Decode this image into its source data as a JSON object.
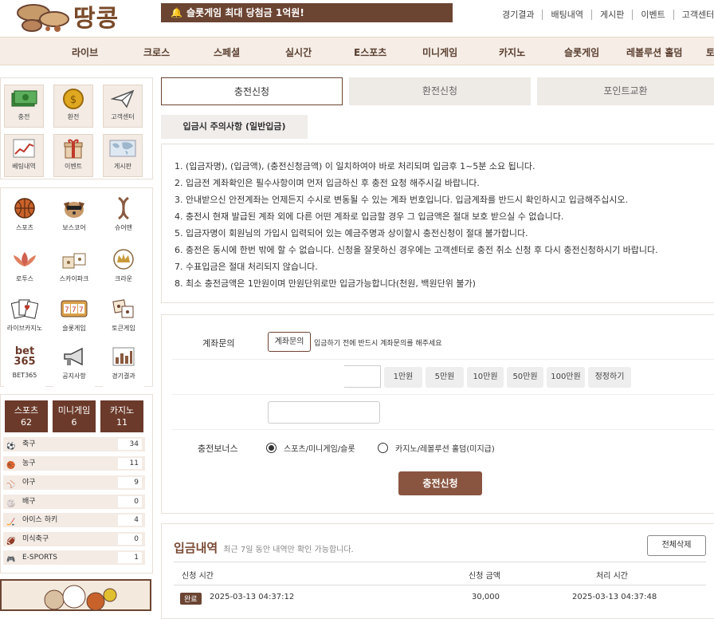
{
  "header": {
    "logo_text": "땅콩",
    "notice": "슬롯게임 최대 당첨금 1억원!",
    "links": [
      "경기결과",
      "배팅내역",
      "게시판",
      "이벤트",
      "고객센터"
    ]
  },
  "nav": [
    "라이브",
    "크로스",
    "스페셜",
    "실시간",
    "E스포츠",
    "미니게임",
    "카지노",
    "슬롯게임",
    "레볼루션 홀덤",
    "토"
  ],
  "sidebar": {
    "quick": [
      {
        "label": "충전",
        "icon": "money-icon"
      },
      {
        "label": "환전",
        "icon": "coin-icon"
      },
      {
        "label": "고객센터",
        "icon": "paper-plane-icon"
      },
      {
        "label": "베팅내역",
        "icon": "chart-icon"
      },
      {
        "label": "이벤트",
        "icon": "gift-icon"
      },
      {
        "label": "게시판",
        "icon": "world-map-icon"
      }
    ],
    "games": [
      {
        "label": "스포츠",
        "icon": "basketball-icon"
      },
      {
        "label": "보스코어",
        "icon": "dog-icon"
      },
      {
        "label": "슈어맨",
        "icon": "dna-icon"
      },
      {
        "label": "로투스",
        "icon": "lotus-icon"
      },
      {
        "label": "스카이파크",
        "icon": "dice-box-icon"
      },
      {
        "label": "크라운",
        "icon": "crown-icon"
      },
      {
        "label": "라이브카지노",
        "icon": "cards-icon"
      },
      {
        "label": "슬롯게임",
        "icon": "slot-icon"
      },
      {
        "label": "토큰게임",
        "icon": "dice-icon"
      },
      {
        "label": "BET365",
        "icon": "bet365-icon",
        "logo": "bet 365"
      },
      {
        "label": "공지사항",
        "icon": "megaphone-icon"
      },
      {
        "label": "경기결과",
        "icon": "results-icon"
      }
    ],
    "category_tabs": [
      {
        "label": "스포츠",
        "count": "62"
      },
      {
        "label": "미니게임",
        "count": "6"
      },
      {
        "label": "카지노",
        "count": "11"
      }
    ],
    "sports": [
      {
        "name": "축구",
        "count": "34"
      },
      {
        "name": "농구",
        "count": "11"
      },
      {
        "name": "야구",
        "count": "9"
      },
      {
        "name": "배구",
        "count": "0"
      },
      {
        "name": "아이스 하키",
        "count": "4"
      },
      {
        "name": "미식축구",
        "count": "0"
      },
      {
        "name": "E-SPORTS",
        "count": "1"
      }
    ]
  },
  "tabs": [
    "충전신청",
    "환전신청",
    "포인트교환"
  ],
  "notice_title": "입금시 주의사항 (일반입금)",
  "rules": [
    "1. (입금자명), (입금액), (충전신청금액) 이 일치하여야 바로 처리되며 입금후 1~5분 소요 됩니다.",
    "2. 입금전 계좌확인은 필수사항이며 먼저 입금하신 후 충전 요청 해주시길 바랍니다.",
    "3. 안내받으신 안전계좌는 언제든지 수시로 변동될 수 있는 계좌 번호입니다. 입금계좌를 반드시 확인하시고 입금해주십시오.",
    "4. 충전시 현재 발급된 계좌 외에 다른 어떤 계좌로 입금할 경우 그 입금액은 절대 보호 받으실 수 없습니다.",
    "5. 입금자명이 회원님의 가입시 입력되어 있는 예금주명과 상이할시 충전신청이 절대 불가합니다.",
    "6. 충전은 동시에 한번 밖에 할 수 없습니다. 신청을 잘못하신 경우에는 고객센터로 충전 취소 신청 후 다시 충전신청하시기 바랍니다.",
    "7. 수표입금은 절대 처리되지 않습니다.",
    "8. 최소 충전금액은 1만원이며 만원단위로만 입금가능합니다(천원, 백원단위 불가)"
  ],
  "form": {
    "account_label": "계좌문의",
    "account_button": "계좌문의",
    "account_hint": "입금하기 전에 반드시 계좌문의를 해주세요",
    "amount_buttons": [
      "1만원",
      "5만원",
      "10만원",
      "50만원",
      "100만원",
      "정정하기"
    ],
    "bonus_label": "충전보너스",
    "bonus_options": [
      "스포츠/미니게임/슬롯",
      "카지노/레볼루션 홀덤(미지급)"
    ],
    "submit": "충전신청"
  },
  "history": {
    "title": "입금내역",
    "subtitle": "최근 7일 동안 내역만 확인 가능합니다.",
    "delete_all": "전체삭제",
    "columns": [
      "신청 시간",
      "신청 금액",
      "처리 시간"
    ],
    "rows": [
      {
        "status": "완료",
        "time": "2025-03-13 04:37:12",
        "amount": "30,000",
        "processed": "2025-03-13 04:37:48"
      }
    ]
  },
  "colors": {
    "brand": "#6b4432",
    "nav_bg": "#f5ede6",
    "accent_btn": "#8a5540"
  }
}
